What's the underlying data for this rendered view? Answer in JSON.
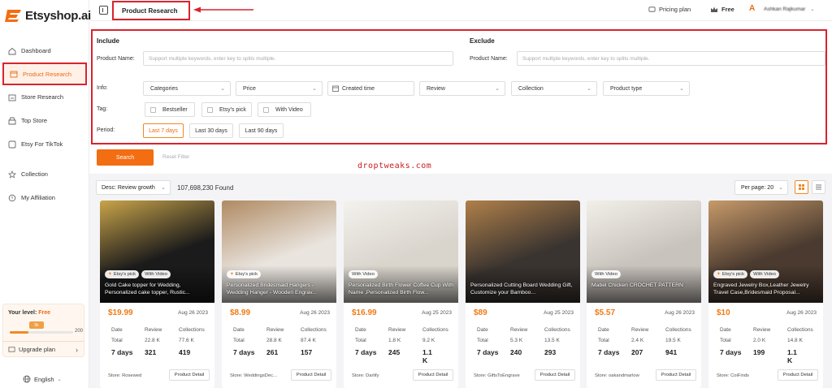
{
  "brand": {
    "name": "Etsyshop.ai"
  },
  "sidebar": {
    "items": [
      {
        "label": "Dashboard",
        "icon": "home-icon"
      },
      {
        "label": "Product Research",
        "icon": "product-box-icon",
        "active": true
      },
      {
        "label": "Store Research",
        "icon": "store-icon"
      },
      {
        "label": "Top Store",
        "icon": "top-store-icon"
      },
      {
        "label": "Etsy For TikTok",
        "icon": "tiktok-icon"
      },
      {
        "label": "Collection",
        "icon": "star-icon"
      },
      {
        "label": "My Affiliation",
        "icon": "affiliation-icon"
      }
    ],
    "level": {
      "label": "Your level:",
      "value": "Free",
      "badge": "5k",
      "max": "200",
      "progress": 0.3
    },
    "upgrade_label": "Upgrade plan",
    "language": "English"
  },
  "topbar": {
    "page_tab": "Product Research",
    "pricing_label": "Pricing plan",
    "plan_label": "Free",
    "user_initial": "A",
    "user_name": "Ashkan Rajkumar"
  },
  "filters": {
    "include_title": "Include",
    "exclude_title": "Exclude",
    "product_name_label": "Product Name:",
    "include_placeholder": "Support multiple keywords, enter key to splits multiple.",
    "exclude_placeholder": "Support multiple keywords, enter key to splits multiple.",
    "info_label": "Info:",
    "info_selects": [
      "Categories",
      "Price",
      "Created time",
      "Review",
      "Collection",
      "Product type"
    ],
    "tag_label": "Tag:",
    "tags": [
      "Bestseller",
      "Etsy's pick",
      "With Video"
    ],
    "period_label": "Period:",
    "periods": [
      "Last 7 days",
      "Last 30 days",
      "Last 90 days"
    ],
    "period_selected": 0
  },
  "actions": {
    "search": "Search",
    "reset": "Reset Filter"
  },
  "watermark": "droptweaks.com",
  "results": {
    "sort_label": "Desc: Review growth",
    "found": "107,698,230 Found",
    "per_page": "Per page: 20"
  },
  "stat_headers": {
    "date": "Date",
    "review": "Review",
    "collections": "Collections",
    "total": "Total",
    "period": "7 days"
  },
  "detail_label": "Product Detail",
  "cards": [
    {
      "badges": [
        "Etsy's pick",
        "With Video"
      ],
      "title": "Gold Cake topper for Wedding, Personalized cake topper, Rustic...",
      "price": "$19.99",
      "date": "Aug 26 2023",
      "review_total": "22.8 K",
      "collections_total": "77.6 K",
      "review_growth": "321",
      "collections_growth": "419",
      "store": "Store: Rosewed",
      "bg": "#1b1b1b",
      "accent": "#c9a44a"
    },
    {
      "badges": [
        "Etsy's pick"
      ],
      "title": "Personalized Bridesmaid Hangers - Wedding Hanger - Wooden Engrav...",
      "price": "$8.99",
      "date": "Aug 26 2023",
      "review_total": "28.8 K",
      "collections_total": "87.4 K",
      "review_growth": "261",
      "collections_growth": "157",
      "store": "Store: WeddingsDec...",
      "bg": "#e9e4de",
      "accent": "#b08a62"
    },
    {
      "badges": [
        "With Video"
      ],
      "title": "Personalized Birth Flower Coffee Cup With Name ,Personalized Birth Flow...",
      "price": "$16.99",
      "date": "Aug 25 2023",
      "review_total": "1.8 K",
      "collections_total": "9.2 K",
      "review_growth": "245",
      "collections_growth": "1.1 K",
      "store": "Store: Darlify",
      "bg": "#d9d4cc",
      "accent": "#f4f2ee"
    },
    {
      "badges": [],
      "title": "Personalized Cutting Board Wedding Gift, Customize your Bamboo...",
      "price": "$89",
      "date": "Aug 25 2023",
      "review_total": "5.3 K",
      "collections_total": "13.5 K",
      "review_growth": "240",
      "collections_growth": "293",
      "store": "Store: GiftsToEngrave",
      "bg": "#3a3430",
      "accent": "#b0804a"
    },
    {
      "badges": [
        "With Video"
      ],
      "title": "Mabel Chicken CROCHET PATTERN",
      "price": "$5.57",
      "date": "Aug 26 2023",
      "review_total": "2.4 K",
      "collections_total": "19.5 K",
      "review_growth": "207",
      "collections_growth": "941",
      "store": "Store: oakandmarlow",
      "bg": "#c9c3bd",
      "accent": "#f2efe9"
    },
    {
      "badges": [
        "Etsy's pick",
        "With Video"
      ],
      "title": "Engraved Jewelry Box,Leather Jewelry Travel Case,Bridesmaid Proposal...",
      "price": "$10",
      "date": "Aug 26 2023",
      "review_total": "2.0 K",
      "collections_total": "14.8 K",
      "review_growth": "199",
      "collections_growth": "1.1 K",
      "store": "Store: CoiFinds",
      "bg": "#4a3a2f",
      "accent": "#c79a6a"
    }
  ]
}
